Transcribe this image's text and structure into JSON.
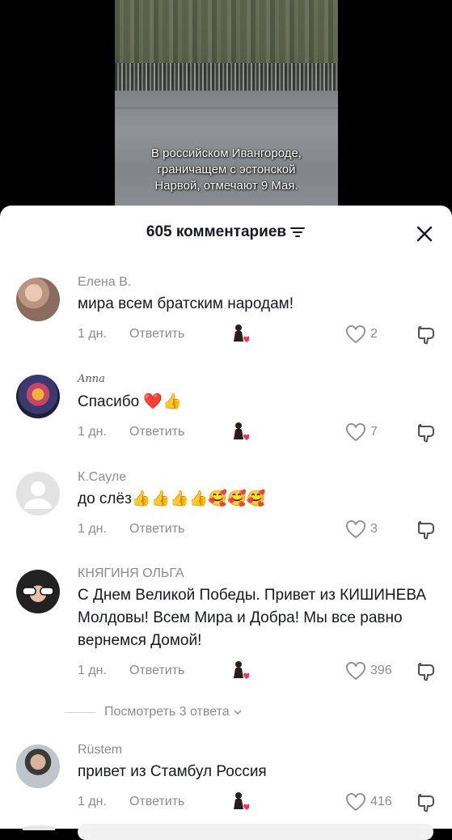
{
  "video": {
    "caption_lines": [
      "В российском Ивангороде,",
      "граничащем с эстонской",
      "Нарвой, отмечают 9 Мая."
    ]
  },
  "sheet": {
    "title": "605 комментариев"
  },
  "comments": [
    {
      "author": "Елена В.",
      "text": "мира всем братским народам!",
      "time": "1 дн.",
      "reply": "Ответить",
      "likes": "2"
    },
    {
      "author": "Anna",
      "text": "Спасибо ❤️👍",
      "time": "1 дн.",
      "reply": "Ответить",
      "likes": "7"
    },
    {
      "author": "К.Сауле",
      "text": "до слёз👍👍👍👍🥰🥰🥰",
      "time": "1 дн.",
      "reply": "Ответить",
      "likes": "3"
    },
    {
      "author": "КНЯГИНЯ ОЛЬГА",
      "text": "С Днем Великой Победы. Привет из КИШИНЕВА Молдовы! Всем Мира и Добра! Мы все равно вернемся Домой!",
      "time": "1 дн.",
      "reply": "Ответить",
      "likes": "396"
    },
    {
      "author": "Rüstem",
      "text": "привет из Стамбул Россия",
      "time": "1 дн.",
      "reply": "Ответить",
      "likes": "416"
    }
  ],
  "view_replies": "Посмотреть 3 ответа"
}
